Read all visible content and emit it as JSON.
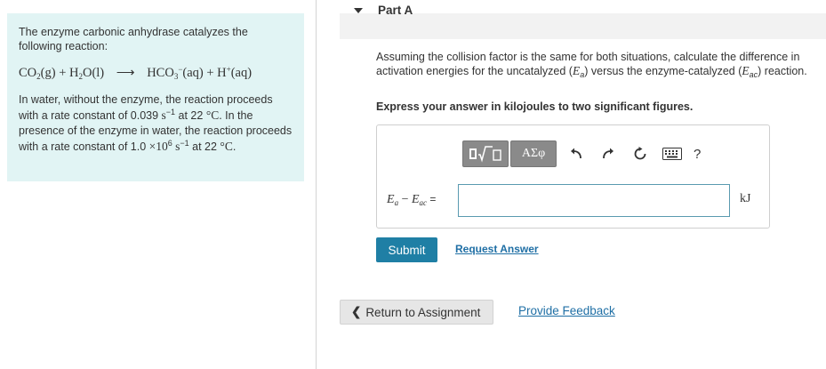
{
  "problem": {
    "intro": "The enzyme carbonic anhydrase catalyzes the following reaction:",
    "equation": {
      "r1": "CO",
      "r1_sub": "2",
      "r1_state": "(g) + H",
      "r2_sub": "2",
      "r2_rest": "O(l)",
      "arrow": "⟶",
      "p1": "HCO",
      "p1_sub": "3",
      "p1_sup": "−",
      "p1_state": "(aq) + H",
      "p2_sup": "+",
      "p2_state": "(aq)"
    },
    "para": {
      "t1": "In water, without the enzyme, the reaction proceeds with a rate constant of 0.039 ",
      "unit1": "s",
      "unit1_sup": "−1",
      "t2": " at 22 ",
      "temp1": "°C",
      "t3": ". In the presence of the enzyme in water, the reaction proceeds with a rate constant of 1.0 ",
      "times": "×10",
      "exp": "6",
      "unit2": " s",
      "unit2_sup": "−1",
      "t4": " at 22 ",
      "temp2": "°C",
      "t5": "."
    }
  },
  "part": {
    "title": "Part A",
    "question": {
      "q1": "Assuming the collision factor is the same for both situations, calculate the difference in activation energies for the uncatalyzed (",
      "ea": "E",
      "ea_sub": "a",
      "q2": ") versus the enzyme-catalyzed (",
      "eac": "E",
      "eac_sub": "ac",
      "q3": ") reaction."
    },
    "instruction": "Express your answer in kilojoules to two significant figures."
  },
  "toolbar": {
    "greek_label": "ΑΣφ",
    "help_label": "?"
  },
  "answer": {
    "label_e": "E",
    "label_a": "a",
    "label_minus": " − ",
    "label_e2": "E",
    "label_ac": "ac",
    "label_eq": " =",
    "value": "",
    "unit": "kJ"
  },
  "actions": {
    "submit": "Submit",
    "request": "Request Answer",
    "return": "Return to Assignment",
    "feedback": "Provide Feedback"
  }
}
